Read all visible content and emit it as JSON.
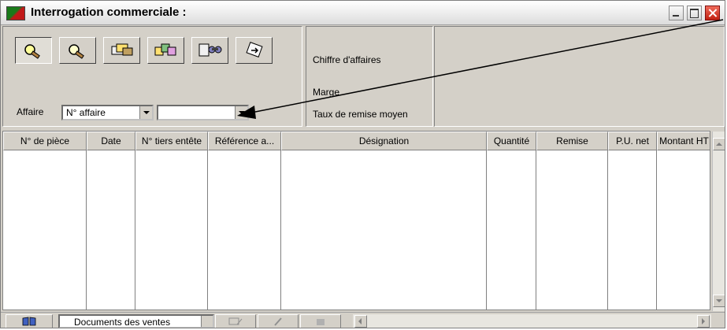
{
  "window": {
    "title": "Interrogation commerciale :",
    "controls": [
      "minimize-icon",
      "maximize-icon",
      "close-icon"
    ]
  },
  "toolbar": {
    "buttons": [
      {
        "icon": "search-icon",
        "pressed": true
      },
      {
        "icon": "search-icon",
        "pressed": false
      },
      {
        "icon": "documents-icon",
        "pressed": false
      },
      {
        "icon": "multi-documents-icon",
        "pressed": false
      },
      {
        "icon": "binoculars-icon",
        "pressed": false
      },
      {
        "icon": "document-arrow-icon",
        "pressed": false
      }
    ]
  },
  "filter": {
    "affaire_label": "Affaire",
    "type_select_value": "N° affaire",
    "value_select_value": ""
  },
  "totals": {
    "chiffre_affaires_label": "Chiffre d'affaires",
    "marge_label": "Marge",
    "taux_remise_label": "Taux de remise moyen"
  },
  "table": {
    "columns": [
      "N° de pièce",
      "Date",
      "N° tiers entête",
      "Référence a...",
      "Désignation",
      "Quantité",
      "Remise",
      "P.U. net",
      "Montant HT"
    ],
    "rows": []
  },
  "bottom": {
    "view_select_value": "Documents des ventes"
  },
  "colors": {
    "window_bg": "#d4d0c8",
    "close_button": "#d0301f",
    "annotation_arrow": "#000000"
  }
}
